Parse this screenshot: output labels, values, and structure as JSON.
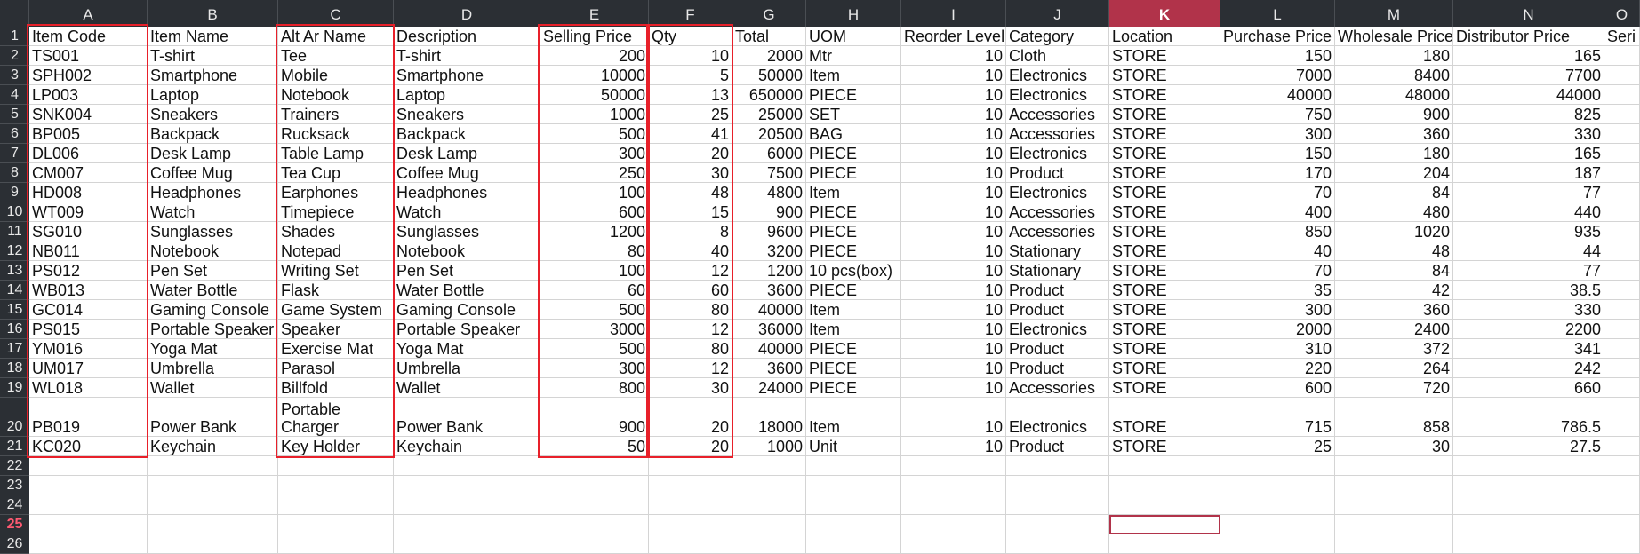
{
  "columns": [
    "A",
    "B",
    "C",
    "D",
    "E",
    "F",
    "G",
    "H",
    "I",
    "J",
    "K",
    "L",
    "M",
    "N",
    "O"
  ],
  "selected_column": "K",
  "selected_row": 25,
  "row_numbers": [
    1,
    2,
    3,
    4,
    5,
    6,
    7,
    8,
    9,
    10,
    11,
    12,
    13,
    14,
    15,
    16,
    17,
    18,
    19,
    20,
    21,
    22,
    23,
    24,
    25,
    26
  ],
  "headers": [
    "Item Code",
    "Item Name",
    "Alt Ar Name",
    "Description",
    "Selling Price",
    "Qty",
    "Total",
    "UOM",
    "Reorder Level",
    "Category",
    "Location",
    "Purchase Price",
    "Wholesale Price",
    "Distributor Price",
    "Seri"
  ],
  "rows": [
    [
      "TS001",
      "T-shirt",
      "Tee",
      "T-shirt",
      "200",
      "10",
      "2000",
      "Mtr",
      "10",
      "Cloth",
      "STORE",
      "150",
      "180",
      "165"
    ],
    [
      "SPH002",
      "Smartphone",
      "Mobile",
      "Smartphone",
      "10000",
      "5",
      "50000",
      "Item",
      "10",
      "Electronics",
      "STORE",
      "7000",
      "8400",
      "7700"
    ],
    [
      "LP003",
      "Laptop",
      "Notebook",
      "Laptop",
      "50000",
      "13",
      "650000",
      "PIECE",
      "10",
      "Electronics",
      "STORE",
      "40000",
      "48000",
      "44000"
    ],
    [
      "SNK004",
      "Sneakers",
      "Trainers",
      "Sneakers",
      "1000",
      "25",
      "25000",
      "SET",
      "10",
      "Accessories",
      "STORE",
      "750",
      "900",
      "825"
    ],
    [
      "BP005",
      "Backpack",
      "Rucksack",
      "Backpack",
      "500",
      "41",
      "20500",
      "BAG",
      "10",
      "Accessories",
      "STORE",
      "300",
      "360",
      "330"
    ],
    [
      "DL006",
      "Desk Lamp",
      "Table Lamp",
      "Desk Lamp",
      "300",
      "20",
      "6000",
      "PIECE",
      "10",
      "Electronics",
      "STORE",
      "150",
      "180",
      "165"
    ],
    [
      "CM007",
      "Coffee Mug",
      "Tea Cup",
      "Coffee Mug",
      "250",
      "30",
      "7500",
      "PIECE",
      "10",
      "Product",
      "STORE",
      "170",
      "204",
      "187"
    ],
    [
      "HD008",
      "Headphones",
      "Earphones",
      "Headphones",
      "100",
      "48",
      "4800",
      "Item",
      "10",
      "Electronics",
      "STORE",
      "70",
      "84",
      "77"
    ],
    [
      "WT009",
      "Watch",
      "Timepiece",
      "Watch",
      "600",
      "15",
      "900",
      "PIECE",
      "10",
      "Accessories",
      "STORE",
      "400",
      "480",
      "440"
    ],
    [
      "SG010",
      "Sunglasses",
      "Shades",
      "Sunglasses",
      "1200",
      "8",
      "9600",
      "PIECE",
      "10",
      "Accessories",
      "STORE",
      "850",
      "1020",
      "935"
    ],
    [
      "NB011",
      "Notebook",
      "Notepad",
      "Notebook",
      "80",
      "40",
      "3200",
      "PIECE",
      "10",
      "Stationary",
      "STORE",
      "40",
      "48",
      "44"
    ],
    [
      "PS012",
      "Pen Set",
      "Writing Set",
      "Pen Set",
      "100",
      "12",
      "1200",
      "10 pcs(box)",
      "10",
      "Stationary",
      "STORE",
      "70",
      "84",
      "77"
    ],
    [
      "WB013",
      "Water Bottle",
      "Flask",
      "Water Bottle",
      "60",
      "60",
      "3600",
      "PIECE",
      "10",
      "Product",
      "STORE",
      "35",
      "42",
      "38.5"
    ],
    [
      "GC014",
      "Gaming Console",
      "Game System",
      "Gaming Console",
      "500",
      "80",
      "40000",
      "Item",
      "10",
      "Product",
      "STORE",
      "300",
      "360",
      "330"
    ],
    [
      "PS015",
      "Portable Speaker",
      "Speaker",
      "Portable Speaker",
      "3000",
      "12",
      "36000",
      "Item",
      "10",
      "Electronics",
      "STORE",
      "2000",
      "2400",
      "2200"
    ],
    [
      "YM016",
      "Yoga Mat",
      "Exercise Mat",
      "Yoga Mat",
      "500",
      "80",
      "40000",
      "PIECE",
      "10",
      "Product",
      "STORE",
      "310",
      "372",
      "341"
    ],
    [
      "UM017",
      "Umbrella",
      "Parasol",
      "Umbrella",
      "300",
      "12",
      "3600",
      "PIECE",
      "10",
      "Product",
      "STORE",
      "220",
      "264",
      "242"
    ],
    [
      "WL018",
      "Wallet",
      "Billfold",
      "Wallet",
      "800",
      "30",
      "24000",
      "PIECE",
      "10",
      "Accessories",
      "STORE",
      "600",
      "720",
      "660"
    ],
    [
      "PB019",
      "Power Bank",
      "Portable Charger",
      "Power Bank",
      "900",
      "20",
      "18000",
      "Item",
      "10",
      "Electronics",
      "STORE",
      "715",
      "858",
      "786.5"
    ],
    [
      "KC020",
      "Keychain",
      "Key Holder",
      "Keychain",
      "50",
      "20",
      "1000",
      "Unit",
      "10",
      "Product",
      "STORE",
      "25",
      "30",
      "27.5"
    ]
  ],
  "numeric_columns": [
    4,
    5,
    6,
    8,
    11,
    12,
    13
  ],
  "highlighted_columns": [
    "A",
    "C",
    "E",
    "F"
  ],
  "highlight_color": "#e8202a"
}
